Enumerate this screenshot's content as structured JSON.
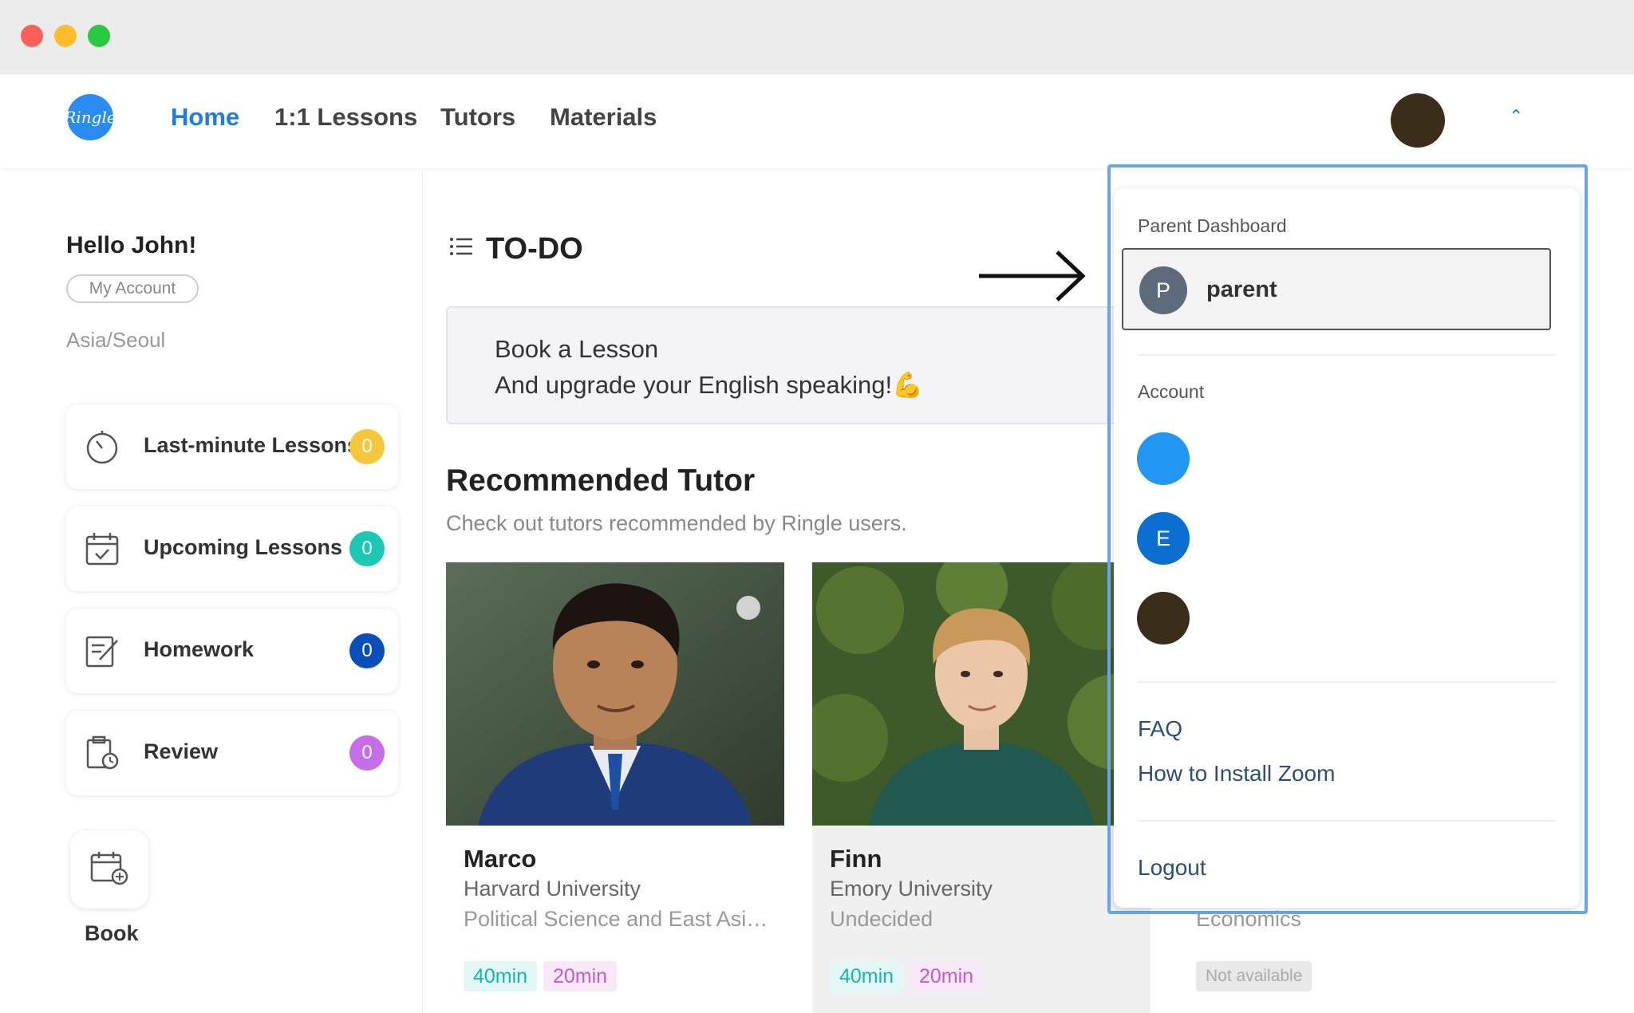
{
  "nav": {
    "logo_text": "Ringle",
    "links": [
      "Home",
      "1:1 Lessons",
      "Tutors",
      "Materials"
    ],
    "active": "Home"
  },
  "sidebar": {
    "greeting": "Hello John!",
    "my_account": "My Account",
    "timezone": "Asia/Seoul",
    "items": [
      {
        "label": "Last-minute Lessons",
        "count": "0",
        "badge_color": "#f7c73b",
        "icon": "timer-icon"
      },
      {
        "label": "Upcoming Lessons",
        "count": "0",
        "badge_color": "#1cc7b5",
        "icon": "calendar-check-icon"
      },
      {
        "label": "Homework",
        "count": "0",
        "badge_color": "#0a4fb8",
        "icon": "pencil-note-icon"
      },
      {
        "label": "Review",
        "count": "0",
        "badge_color": "#c66ee8",
        "icon": "clipboard-clock-icon"
      }
    ],
    "book_label": "Book"
  },
  "main": {
    "todo_title": "TO-DO",
    "todo_card": {
      "line1": "Book a Lesson",
      "line2": "And upgrade your English speaking!💪"
    },
    "recommended_title": "Recommended Tutor",
    "recommended_sub": "Check out tutors recommended by Ringle users.",
    "tutors": [
      {
        "name": "Marco",
        "university": "Harvard University",
        "major": "Political Science and East Asi…",
        "tags": [
          "40min",
          "20min"
        ]
      },
      {
        "name": "Finn",
        "university": "Emory University",
        "major": "Undecided",
        "tags": [
          "40min",
          "20min"
        ]
      },
      {
        "name": "",
        "university": "",
        "major": "Economics",
        "tags": [
          "Not available"
        ]
      }
    ]
  },
  "dropdown": {
    "parent_section": "Parent Dashboard",
    "parent_avatar_letter": "P",
    "parent_name": "parent",
    "account_section": "Account",
    "accounts": [
      {
        "letter": "",
        "color": "#2196f3"
      },
      {
        "letter": "E",
        "color": "#0a6fd1"
      },
      {
        "letter": "",
        "color": "#3a2e1a"
      }
    ],
    "faq": "FAQ",
    "zoom": "How to Install Zoom",
    "logout": "Logout"
  }
}
